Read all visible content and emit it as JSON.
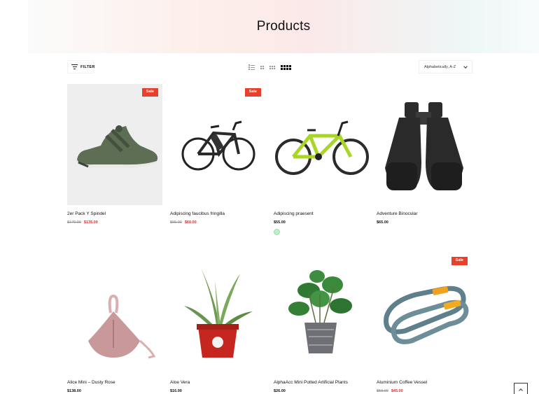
{
  "hero": {
    "title": "Products"
  },
  "toolbar": {
    "filter_label": "FILTER",
    "sort_label": "Alphabetically, A-Z"
  },
  "products": [
    {
      "name": "2er Pack Y Spindel",
      "old_price": "$170.00",
      "price": "$135.00",
      "badge": "Sale"
    },
    {
      "name": "Adipiscing faucibus fringilla",
      "old_price": "$65.00",
      "price": "$60.00",
      "badge": "Sale"
    },
    {
      "name": "Adipiscing praesent",
      "price": "$55.00",
      "swatch": "#bdf2c7"
    },
    {
      "name": "Adventure Binocular",
      "price": "$65.00"
    },
    {
      "name": "Alice Mini – Dusty Rose",
      "price": "$138.00"
    },
    {
      "name": "Aloe Vera",
      "price": "$16.00"
    },
    {
      "name": "AlphaAcc Mini Potted Artificial Plants",
      "price": "$26.00"
    },
    {
      "name": "Aluminium Coffee Vessel",
      "old_price": "$59.00",
      "price": "$45.00",
      "badge": "Sale"
    }
  ],
  "colors": {
    "sale_badge": "#e8402b",
    "sale_price": "#e02b2b"
  }
}
